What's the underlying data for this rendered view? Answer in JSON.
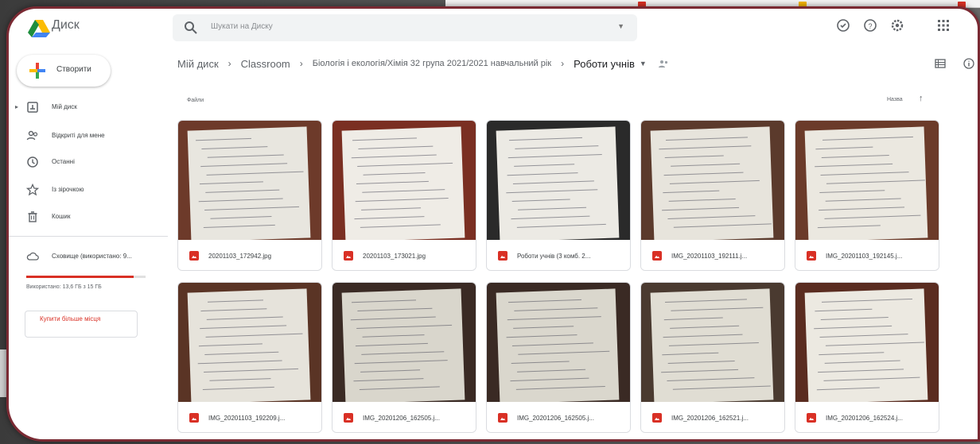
{
  "app": {
    "name": "Диск",
    "search_placeholder": "Шукати на Диску"
  },
  "nav": {
    "create_label": "Створити",
    "items": [
      {
        "label": "Мій диск",
        "icon": "my-drive-icon"
      },
      {
        "label": "Відкриті для мене",
        "icon": "shared-with-me-icon"
      },
      {
        "label": "Останні",
        "icon": "recent-clock-icon"
      },
      {
        "label": "Із зірочкою",
        "icon": "star-icon"
      },
      {
        "label": "Кошик",
        "icon": "trash-icon"
      }
    ],
    "storage_label": "Сховище (використано: 9...",
    "storage_usage": "Використано: 13,6 ГБ з 15 ГБ",
    "storage_fraction": 0.9,
    "buy_label": "Купити більше місця"
  },
  "breadcrumb": [
    "Мій диск",
    "Classroom",
    "Біологія і екологія/Хімія 32 група 2021/2021 навчальний рік",
    "Роботи учнів"
  ],
  "files_label": "Файли",
  "sort_label": "Назва",
  "files": [
    {
      "name": "20201103_172942.jpg"
    },
    {
      "name": "20201103_173021.jpg"
    },
    {
      "name": "Роботи учнів (3 комб. 2..."
    },
    {
      "name": "IMG_20201103_192111.j..."
    },
    {
      "name": "IMG_20201103_192145.j..."
    },
    {
      "name": "IMG_20201103_192209.j..."
    },
    {
      "name": "IMG_20201206_162505.j..."
    },
    {
      "name": "IMG_20201206_162505.j..."
    },
    {
      "name": "IMG_20201206_162521.j..."
    },
    {
      "name": "IMG_20201206_162524.j..."
    }
  ],
  "colors": {
    "accent_red": "#d93025",
    "frame": "#7a2a33",
    "text": "#3c4043"
  }
}
